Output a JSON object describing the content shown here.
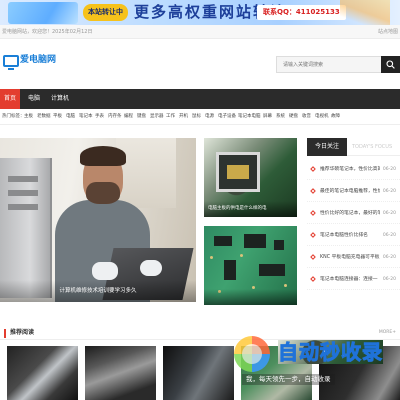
{
  "banner": {
    "badge": "本站转让中",
    "slogan": "更多高权重网站转让",
    "contact": "联系QQ：411025133"
  },
  "topbar": {
    "welcome": "爱电脑网站，欢迎您！",
    "date": "2025年02月12日",
    "right": "站点地图"
  },
  "header": {
    "logo_text": "爱电脑网",
    "search_placeholder": "请输入关键词搜索"
  },
  "nav": {
    "items": [
      {
        "label": "首页"
      },
      {
        "label": "电脑"
      },
      {
        "label": "计算机"
      }
    ]
  },
  "tags": {
    "label": "热门标签：",
    "items": [
      "主板",
      "老数据",
      "平板",
      "电脑",
      "笔记本",
      "手表",
      "内存条",
      "编程",
      "键盘",
      "显示器",
      "工作",
      "开机",
      "鼠标",
      "电源",
      "电子设备",
      "笔记本电脑",
      "屏幕",
      "系统",
      "硬盘",
      "收音",
      "电视机",
      "故障"
    ]
  },
  "slider": {
    "caption": "计算机维修技术培训要学习多久"
  },
  "tiles": [
    {
      "caption": "电脑主板的供电是什么样的电"
    },
    {
      "caption": ""
    }
  ],
  "sidebar": {
    "tab": "今日关注",
    "tab_en": "TODAY'S FOCUS",
    "items": [
      {
        "title": "推荐华硕笔记本，性价比高的",
        "date": "06-20"
      },
      {
        "title": "最佳的笔记本电脑推荐，性价比",
        "date": "06-20"
      },
      {
        "title": "性价比好的笔记本，最好的笔记本",
        "date": "06-20"
      },
      {
        "title": "笔记本电脑性价比排名",
        "date": "06-20"
      },
      {
        "title": "KNC 平板电脑充电器可平板",
        "date": "06-20"
      },
      {
        "title": "笔记本电脑连接器：连接一",
        "date": "06-20"
      }
    ]
  },
  "recommended": {
    "title": "推荐阅读",
    "more": "MORE+"
  },
  "watermark": {
    "title": "自动秒收录",
    "subtitle": "我，每天领先一步，自动收录"
  }
}
